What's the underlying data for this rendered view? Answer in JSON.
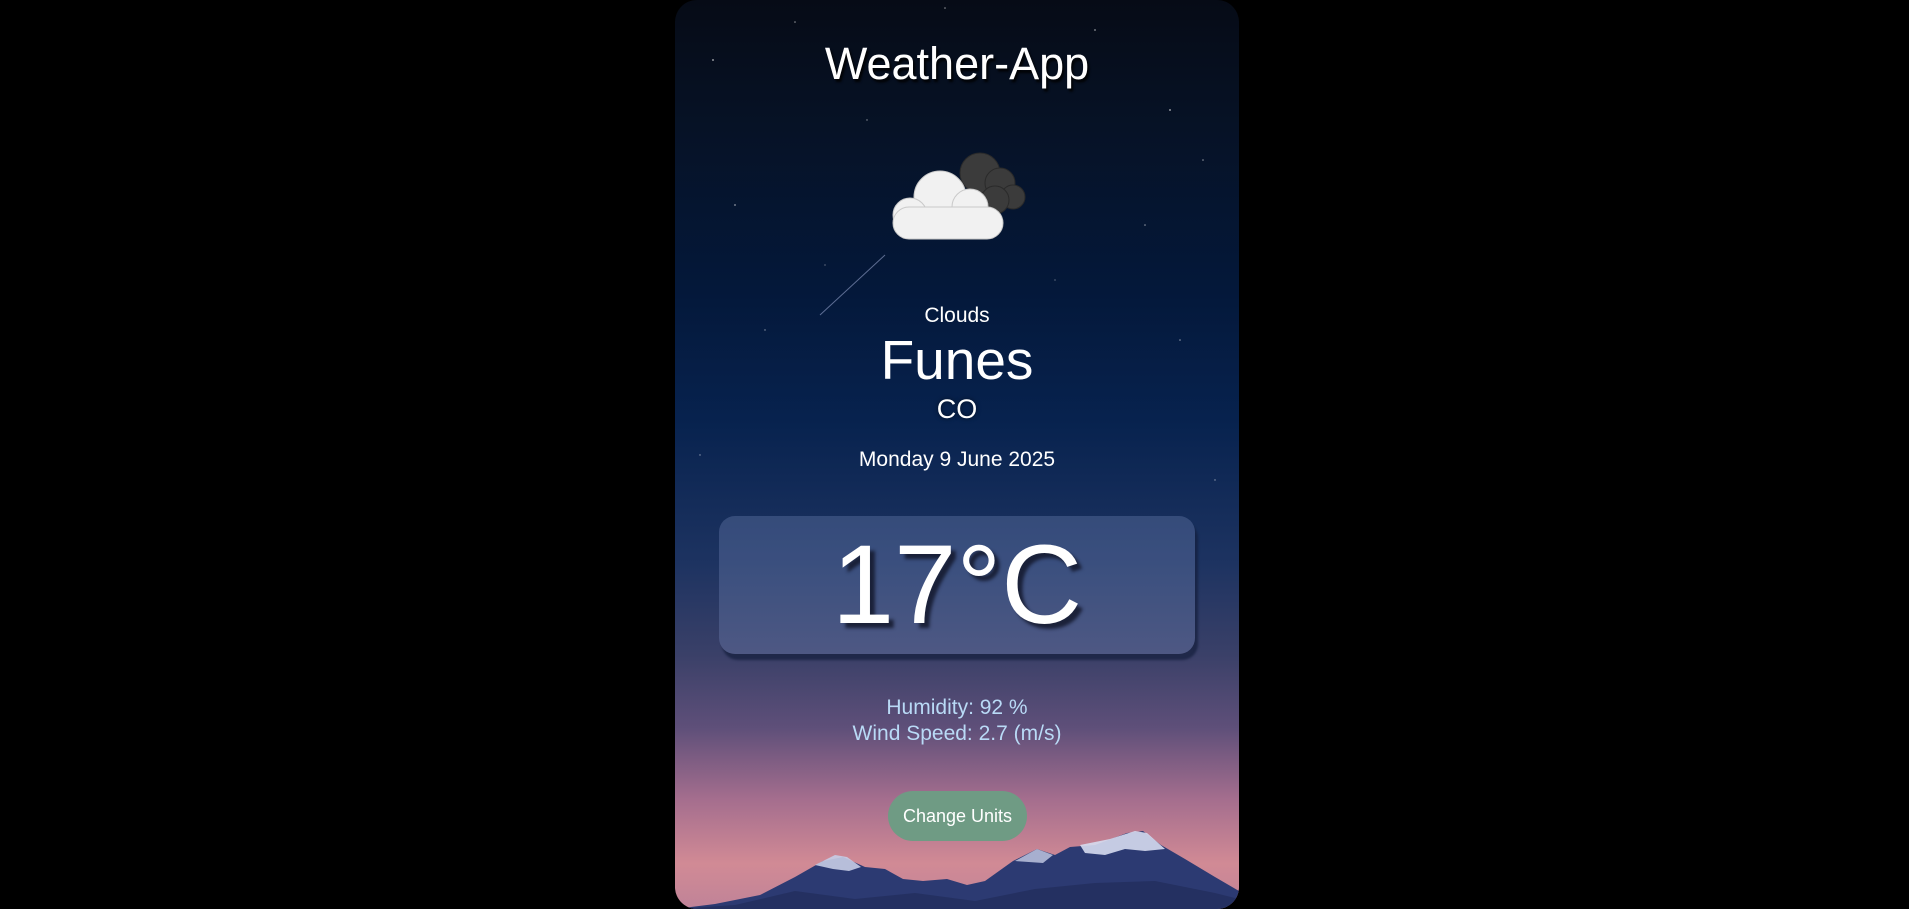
{
  "app": {
    "title": "Weather-App"
  },
  "weather": {
    "icon": "cloudy-icon",
    "condition": "Clouds",
    "city": "Funes",
    "country": "CO",
    "date": "Monday 9 June 2025",
    "temperature": "17°C",
    "humidity": "Humidity: 92 %",
    "wind_speed": "Wind Speed: 2.7 (m/s)"
  },
  "controls": {
    "change_units_label": "Change Units"
  },
  "colors": {
    "page_background": "#000000",
    "button": "#6f9b84",
    "detail_text": "#b9daf6"
  }
}
